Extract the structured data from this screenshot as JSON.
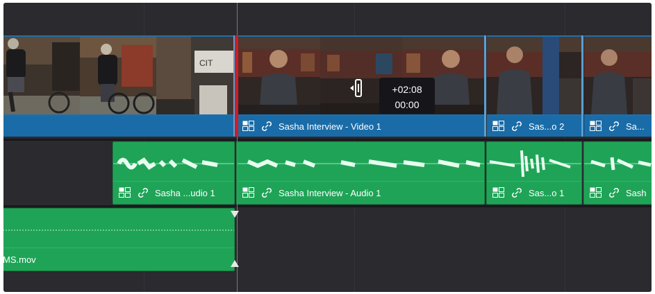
{
  "video_track": {
    "clips": [
      {
        "label": "",
        "scene": "bike"
      },
      {
        "label": "Sasha Interview - Video 1",
        "scene": "interview"
      },
      {
        "label": "Sas...o 2",
        "scene": "seated"
      },
      {
        "label": "Sa...",
        "scene": "seated2"
      }
    ]
  },
  "audio_track_1": {
    "clips": [
      {
        "label": "Sasha ...udio 1"
      },
      {
        "label": "Sasha Interview - Audio 1"
      },
      {
        "label": "Sas...o 1"
      },
      {
        "label": "Sash"
      }
    ]
  },
  "audio_track_2": {
    "clips": [
      {
        "label": "MS.mov"
      }
    ]
  },
  "trim_tooltip": {
    "offset": "+02:08",
    "duration": "00:00"
  },
  "icons": {
    "clip_type": "clip-type-icon",
    "link": "link-icon",
    "trim_cursor": "trim-cursor-icon"
  },
  "colors": {
    "timeline_bg": "#2a2a2f",
    "video_clip": "#1e6fae",
    "audio_clip": "#1fa457",
    "playhead_marker": "#d01c25",
    "tooltip_bg": "#15151a"
  }
}
